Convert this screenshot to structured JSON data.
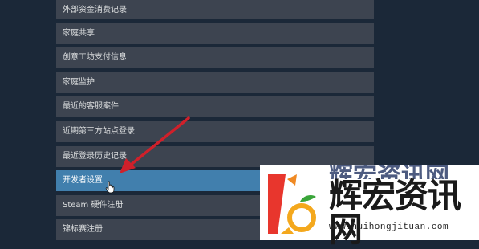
{
  "menu": {
    "items": [
      {
        "label": "外部资金消费记录",
        "active": false
      },
      {
        "label": "家庭共享",
        "active": false
      },
      {
        "label": "创意工坊支付信息",
        "active": false
      },
      {
        "label": "家庭监护",
        "active": false
      },
      {
        "label": "最近的客服案件",
        "active": false
      },
      {
        "label": "近期第三方站点登录",
        "active": false
      },
      {
        "label": "最近登录历史记录",
        "active": false
      },
      {
        "label": "开发者设置",
        "active": true
      },
      {
        "label": "Steam 硬件注册",
        "active": false
      },
      {
        "label": "锦标赛注册",
        "active": false
      }
    ]
  },
  "watermark": {
    "title": "辉宏资讯网",
    "url": "www.huihongjituan.com"
  },
  "colors": {
    "background": "#1b2838",
    "item_bg": "#3d4450",
    "item_active_bg": "#417fad",
    "annotation_arrow": "#d0202a"
  }
}
